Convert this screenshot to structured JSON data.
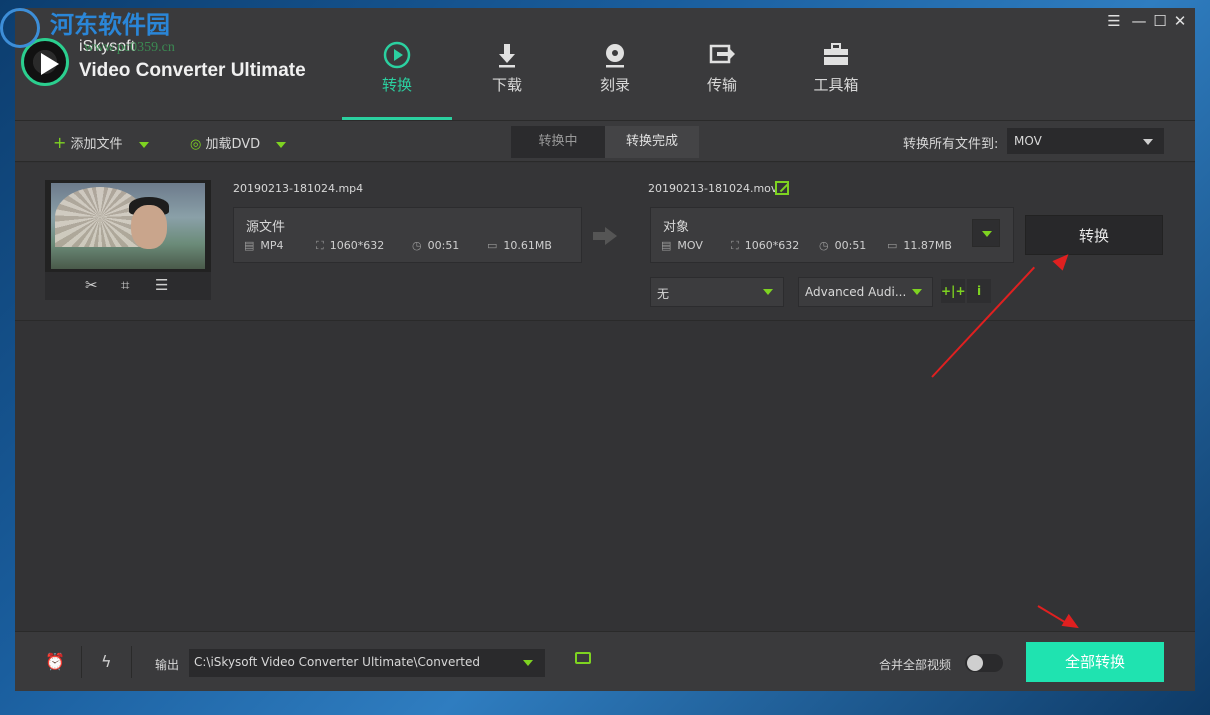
{
  "watermark": {
    "site_name": "河东软件园",
    "url": "www.pc0359.cn"
  },
  "app": {
    "brand_top": "iSkysoft",
    "brand_bottom": "Video Converter Ultimate"
  },
  "nav": {
    "tabs": [
      {
        "label": "转换",
        "icon": "convert-icon",
        "active": true
      },
      {
        "label": "下载",
        "icon": "download-icon",
        "active": false
      },
      {
        "label": "刻录",
        "icon": "burn-icon",
        "active": false
      },
      {
        "label": "传输",
        "icon": "transfer-icon",
        "active": false
      },
      {
        "label": "工具箱",
        "icon": "toolbox-icon",
        "active": false
      }
    ]
  },
  "window_controls": {
    "menu": "☰",
    "minimize": "—",
    "maximize": "☐",
    "close": "✕"
  },
  "toolbar": {
    "add_files": "添加文件",
    "load_dvd": "加载DVD",
    "seg_converting": "转换中",
    "seg_converted": "转换完成",
    "convert_all_to_label": "转换所有文件到:",
    "convert_all_to_value": "MOV"
  },
  "file": {
    "source_name": "20190213-181024.mp4",
    "source_box_title": "源文件",
    "source_format": "MP4",
    "source_resolution": "1060*632",
    "source_duration": "00:51",
    "source_size": "10.61MB",
    "target_name": "20190213-181024.mov",
    "target_box_title": "对象",
    "target_format": "MOV",
    "target_resolution": "1060*632",
    "target_duration": "00:51",
    "target_size": "11.87MB",
    "convert_button": "转换",
    "subtitle_value": "无",
    "audio_value": "Advanced Audi..."
  },
  "footer": {
    "output_label": "输出",
    "output_path": "C:\\iSkysoft Video Converter Ultimate\\Converted",
    "merge_label": "合并全部视频",
    "merge_enabled": false,
    "convert_all_button": "全部转换"
  },
  "colors": {
    "accent": "#2bd0a0",
    "green": "#7ed321",
    "convert_all_bg": "#1fe3b0",
    "annotation_red": "#e02020"
  }
}
